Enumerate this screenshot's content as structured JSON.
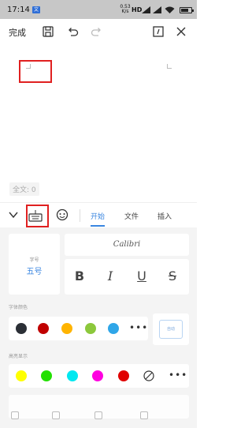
{
  "status_bar": {
    "time": "17:14",
    "app_badge": "文",
    "network_speed": "0.53 K/s",
    "network_type": "HD",
    "battery_level": 0.7
  },
  "toolbar": {
    "done_label": "完成"
  },
  "document": {
    "word_count": "全文: 0"
  },
  "panel": {
    "tabs": [
      "开始",
      "文件",
      "插入"
    ],
    "active_tab": 0
  },
  "font_settings": {
    "size_caption": "字号",
    "size_value": "五号",
    "font_name": "Calibri"
  },
  "sections": {
    "font_color_label": "字体颜色",
    "highlight_label": "高亮显示",
    "custom_label": "自动"
  },
  "colors": {
    "font_colors": [
      "#2b2f36",
      "#c00000",
      "#ffb400",
      "#8cc83c",
      "#2fa6e8"
    ],
    "highlight_colors": [
      "#ffff00",
      "#22e000",
      "#00e8f0",
      "#ff00e0",
      "#e00000"
    ],
    "accent": "#3a86e0",
    "annotation_red": "#e02020"
  }
}
